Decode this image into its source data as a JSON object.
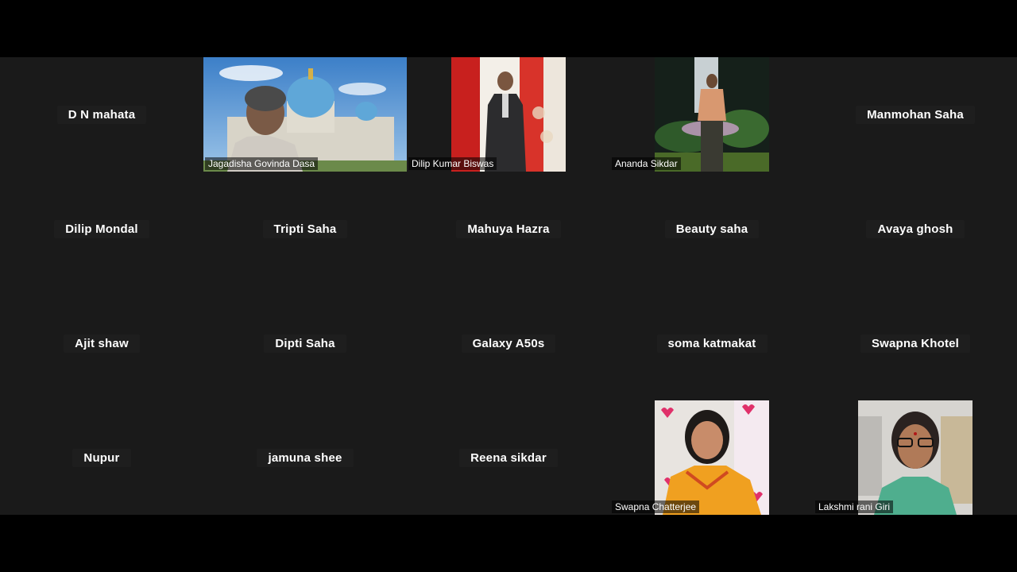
{
  "participants": [
    {
      "name": "D N mahata",
      "video": false
    },
    {
      "name": "Jagadisha Govinda Dasa",
      "video": true
    },
    {
      "name": "Dilip Kumar Biswas",
      "video": true
    },
    {
      "name": "Ananda Sikdar",
      "video": true
    },
    {
      "name": "Manmohan Saha",
      "video": false
    },
    {
      "name": "Dilip Mondal",
      "video": false
    },
    {
      "name": "Tripti Saha",
      "video": false
    },
    {
      "name": "Mahuya Hazra",
      "video": false
    },
    {
      "name": "Beauty saha",
      "video": false
    },
    {
      "name": "Avaya ghosh",
      "video": false
    },
    {
      "name": "Ajit shaw",
      "video": false
    },
    {
      "name": "Dipti Saha",
      "video": false
    },
    {
      "name": "Galaxy A50s",
      "video": false
    },
    {
      "name": "soma katmakat",
      "video": false
    },
    {
      "name": "Swapna Khotel",
      "video": false
    },
    {
      "name": "Nupur",
      "video": false
    },
    {
      "name": "jamuna shee",
      "video": false
    },
    {
      "name": "Reena sikdar",
      "video": false
    },
    {
      "name": "Swapna Chatterjee",
      "video": true
    },
    {
      "name": "Lakshmi rani Giri",
      "video": true
    }
  ],
  "colors": {
    "grid_background": "#1a1a1a",
    "letterbox": "#000000",
    "name_text": "#ffffff"
  }
}
